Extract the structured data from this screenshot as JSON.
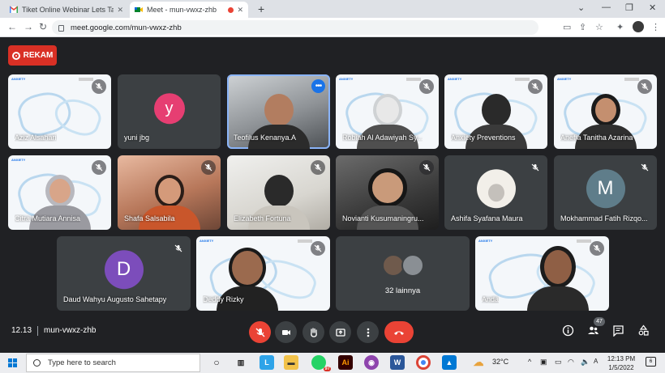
{
  "browser": {
    "tabs": [
      {
        "title": "Tiket Online Webinar Lets Talk A",
        "icon": "gmail-icon",
        "active": false
      },
      {
        "title": "Meet - mun-vwxz-zhb",
        "icon": "meet-icon",
        "active": true,
        "recording": true
      }
    ],
    "url": "meet.google.com/mun-vwxz-zhb"
  },
  "meet": {
    "record_label": "REKAM",
    "accent": "#1a73e8",
    "record_color": "#d93025",
    "tiles": [
      {
        "name": "Aziz Alsahari",
        "muted": true
      },
      {
        "name": "yuni jbg",
        "initial": "y",
        "avatar_color": "#e63e72",
        "muted": false
      },
      {
        "name": "Teofilus Kenanya.A",
        "active": true,
        "menu": true
      },
      {
        "name": "Robiah Al Adawiyah Sy...",
        "muted": true
      },
      {
        "name": "Anxiety Preventions",
        "muted": true
      },
      {
        "name": "Anefia Tanitha Azarina",
        "muted": true
      },
      {
        "name": "Citra Mutiara Annisa",
        "muted": true
      },
      {
        "name": "Shafa Salsabila",
        "muted": true
      },
      {
        "name": "Elizabeth Fortuna",
        "muted": true
      },
      {
        "name": "Novianti Kusumaningru...",
        "muted": true
      },
      {
        "name": "Ashifa Syafana Maura",
        "muted": true
      },
      {
        "name": "Mokhammad Fatih Rizqo...",
        "initial": "M",
        "avatar_color": "#5f7d8a",
        "muted": true
      },
      {
        "name": "Daud Wahyu Augusto Sahetapy",
        "initial": "D",
        "avatar_color": "#7c4dbb",
        "muted": true
      },
      {
        "name": "Deddy Rizky",
        "muted": true
      },
      {
        "name": "32 lainnya"
      },
      {
        "name": "Anda",
        "muted": true
      }
    ],
    "bottom": {
      "time": "12.13",
      "code": "mun-vwxz-zhb",
      "participant_count": "47"
    }
  },
  "taskbar": {
    "search_placeholder": "Type here to search",
    "temperature": "32°C",
    "time": "12:13 PM",
    "date": "1/5/2022",
    "notifications": "6",
    "app_badge": "97"
  }
}
